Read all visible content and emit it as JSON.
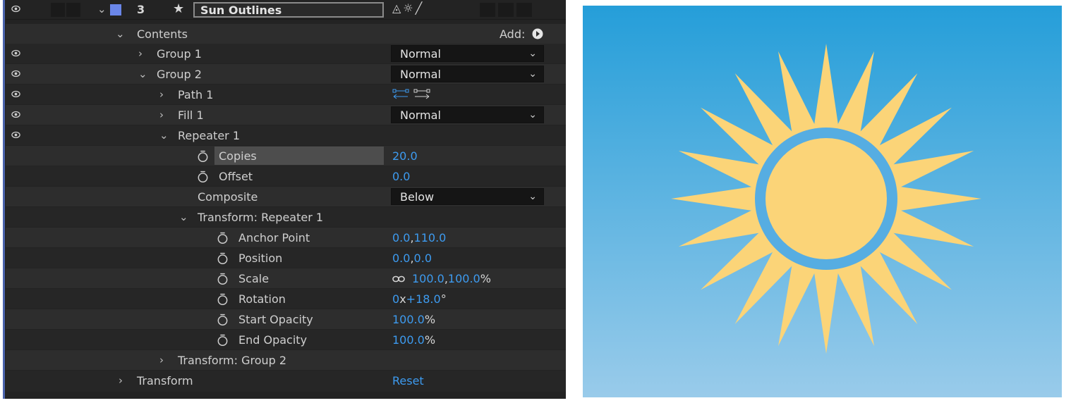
{
  "layer": {
    "index": "3",
    "name": "Sun Outlines",
    "label_color": "#6a86e8",
    "switch_glyphs": "◬☼╱"
  },
  "contents": {
    "label": "Contents",
    "add_label": "Add:"
  },
  "rows": {
    "group1": {
      "label": "Group 1",
      "mode": "Normal"
    },
    "group2": {
      "label": "Group 2",
      "mode": "Normal"
    },
    "path1": {
      "label": "Path 1"
    },
    "fill1": {
      "label": "Fill 1",
      "mode": "Normal"
    },
    "repeater1": {
      "label": "Repeater 1"
    },
    "copies": {
      "label": "Copies",
      "value": "20.0"
    },
    "offset": {
      "label": "Offset",
      "value": "0.0"
    },
    "composite": {
      "label": "Composite",
      "mode": "Below"
    },
    "transform_repeater": {
      "label": "Transform: Repeater 1"
    },
    "anchor_point": {
      "label": "Anchor Point",
      "x": "0.0",
      "y": "110.0"
    },
    "position": {
      "label": "Position",
      "x": "0.0",
      "y": "0.0"
    },
    "scale": {
      "label": "Scale",
      "x": "100.0",
      "y": "100.0",
      "unit": "%"
    },
    "rotation": {
      "label": "Rotation",
      "turns": "0",
      "x_sep": "x",
      "degrees": "+18.0",
      "unit": "°"
    },
    "start_opacity": {
      "label": "Start Opacity",
      "value": "100.0",
      "unit": "%"
    },
    "end_opacity": {
      "label": "End Opacity",
      "value": "100.0",
      "unit": "%"
    },
    "transform_group2": {
      "label": "Transform: Group 2"
    },
    "transform": {
      "label": "Transform",
      "action": "Reset"
    }
  },
  "sun_preview": {
    "ray_count": 20,
    "ray_rotation_deg": 18.0,
    "ray_color": "#fbd478",
    "core_color": "#fbd478",
    "ring_color": "#56ade2",
    "sky_top": "#259ed9",
    "sky_bottom": "#99cbea"
  }
}
